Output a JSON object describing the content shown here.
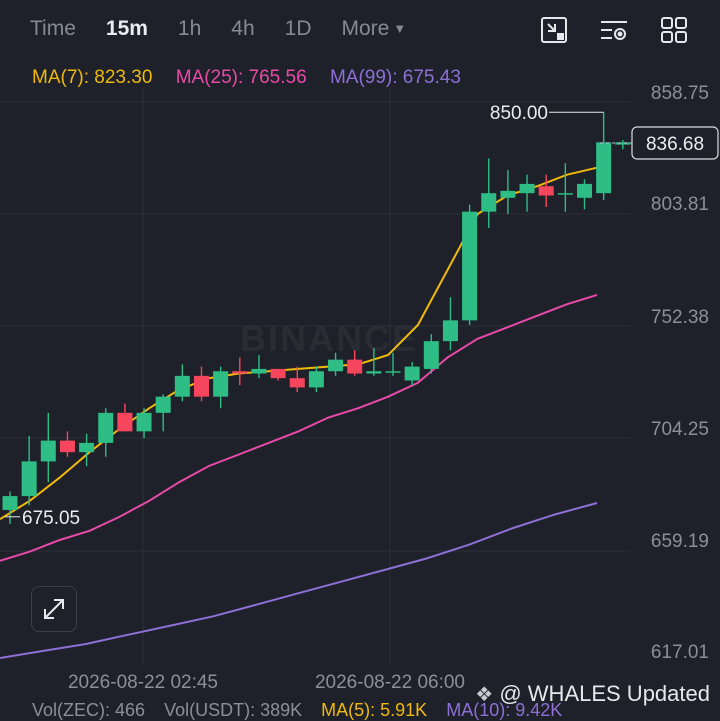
{
  "toolbar": {
    "timeframes": [
      "Time",
      "15m",
      "1h",
      "4h",
      "1D"
    ],
    "active": "15m",
    "more_label": "More",
    "tools": [
      "collapse-icon",
      "indicator-settings-icon",
      "grid-layout-icon"
    ]
  },
  "ma_legend": {
    "ma7": {
      "label": "MA(7): 823.30",
      "color": "#f0b90b"
    },
    "ma25": {
      "label": "MA(25): 765.56",
      "color": "#e84aa8"
    },
    "ma99": {
      "label": "MA(99): 675.43",
      "color": "#8e6fd6"
    }
  },
  "watermark": "BINANCE",
  "credit": "@ WHALES Updated",
  "volume_legend": {
    "zec": "Vol(ZEC): 466",
    "usdt": "Vol(USDT): 389K",
    "ma5": {
      "label": "MA(5): 5.91K",
      "color": "#f0b90b"
    },
    "ma10": {
      "label": "MA(10): 9.42K",
      "color": "#8e6fd6"
    }
  },
  "chart_data": {
    "type": "candlestick",
    "interval": "15m",
    "y_ticks": [
      "858.75",
      "803.81",
      "752.38",
      "704.25",
      "659.19",
      "617.01"
    ],
    "ylim": [
      610,
      870
    ],
    "x_ticks": [
      "2026-08-22 02:45",
      "2026-08-22 06:00"
    ],
    "grid": true,
    "colors": {
      "up": "#2ebd85",
      "down": "#f6465d"
    },
    "current_price": "836.68",
    "annotations": {
      "high": "850.00",
      "low": "675.05"
    },
    "candles": [
      {
        "o": 678,
        "h": 686,
        "l": 672,
        "c": 684
      },
      {
        "o": 684,
        "h": 710,
        "l": 680,
        "c": 699
      },
      {
        "o": 699,
        "h": 720,
        "l": 690,
        "c": 708
      },
      {
        "o": 708,
        "h": 712,
        "l": 701,
        "c": 703
      },
      {
        "o": 703,
        "h": 711,
        "l": 697,
        "c": 707
      },
      {
        "o": 707,
        "h": 722,
        "l": 701,
        "c": 720
      },
      {
        "o": 720,
        "h": 724,
        "l": 712,
        "c": 712
      },
      {
        "o": 712,
        "h": 722,
        "l": 709,
        "c": 720
      },
      {
        "o": 720,
        "h": 728,
        "l": 712,
        "c": 727
      },
      {
        "o": 727,
        "h": 741,
        "l": 725,
        "c": 736
      },
      {
        "o": 736,
        "h": 740,
        "l": 725,
        "c": 727
      },
      {
        "o": 727,
        "h": 740,
        "l": 722,
        "c": 738
      },
      {
        "o": 738,
        "h": 744,
        "l": 732,
        "c": 737
      },
      {
        "o": 737,
        "h": 745,
        "l": 735,
        "c": 739
      },
      {
        "o": 739,
        "h": 739,
        "l": 734,
        "c": 735
      },
      {
        "o": 735,
        "h": 740,
        "l": 729,
        "c": 731
      },
      {
        "o": 731,
        "h": 740,
        "l": 729,
        "c": 738
      },
      {
        "o": 738,
        "h": 746,
        "l": 736,
        "c": 743
      },
      {
        "o": 743,
        "h": 747,
        "l": 736,
        "c": 737
      },
      {
        "o": 737,
        "h": 748,
        "l": 736,
        "c": 738
      },
      {
        "o": 738,
        "h": 746,
        "l": 736,
        "c": 738
      },
      {
        "o": 734,
        "h": 742,
        "l": 732,
        "c": 740
      },
      {
        "o": 739,
        "h": 754,
        "l": 737,
        "c": 751
      },
      {
        "o": 751,
        "h": 770,
        "l": 747,
        "c": 760
      },
      {
        "o": 760,
        "h": 810,
        "l": 758,
        "c": 807
      },
      {
        "o": 807,
        "h": 830,
        "l": 800,
        "c": 815
      },
      {
        "o": 813,
        "h": 825,
        "l": 806,
        "c": 816
      },
      {
        "o": 815,
        "h": 823,
        "l": 807,
        "c": 819
      },
      {
        "o": 818,
        "h": 823,
        "l": 809,
        "c": 814
      },
      {
        "o": 815,
        "h": 828,
        "l": 807,
        "c": 815
      },
      {
        "o": 813,
        "h": 821,
        "l": 808,
        "c": 819
      },
      {
        "o": 815,
        "h": 850,
        "l": 812,
        "c": 837
      },
      {
        "o": 836,
        "h": 838,
        "l": 834,
        "c": 837
      }
    ],
    "series": [
      {
        "name": "MA(7)",
        "color": "#f0b90b",
        "values": [
          674,
          682,
          692,
          703,
          713,
          722,
          730,
          735,
          737,
          738,
          739,
          740,
          741,
          745,
          758,
          782,
          806,
          814,
          818,
          823,
          826
        ]
      },
      {
        "name": "MA(25)",
        "color": "#e84aa8",
        "values": [
          656,
          660,
          665,
          669,
          675,
          682,
          690,
          697,
          702,
          707,
          712,
          718,
          722,
          727,
          733,
          744,
          752,
          757,
          762,
          767,
          771
        ]
      },
      {
        "name": "MA(99)",
        "color": "#8e6fd6",
        "values": [
          614,
          617,
          620,
          624,
          628,
          632,
          637,
          642,
          647,
          652,
          657,
          663,
          670,
          676,
          681
        ]
      }
    ]
  }
}
